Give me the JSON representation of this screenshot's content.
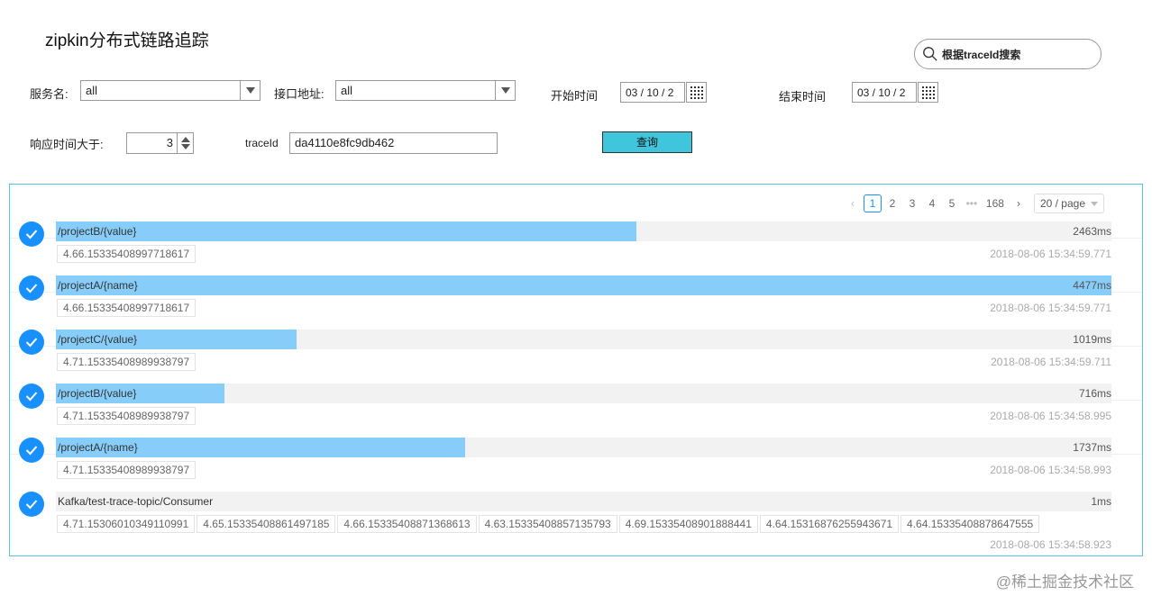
{
  "title": "zipkin分布式链路追踪",
  "search": {
    "placeholder": "根据traceId搜索"
  },
  "filters": {
    "service_label": "服务名:",
    "service_value": "all",
    "endpoint_label": "接口地址:",
    "endpoint_value": "all",
    "start_label": "开始时间",
    "start_value": "03 / 10 / 2",
    "end_label": "结束时间",
    "end_value": "03 / 10 / 2",
    "resp_label": "响应时间大于:",
    "resp_value": "3",
    "traceid_label": "traceId",
    "traceid_value": "da4110e8fc9db462",
    "query_button": "查询"
  },
  "pagination": {
    "pages": [
      "1",
      "2",
      "3",
      "4",
      "5"
    ],
    "current": "1",
    "ellipsis": "•••",
    "last": "168",
    "page_size": "20 / page",
    "prev": "‹",
    "next": "›"
  },
  "traces": [
    {
      "route": "/projectB/{value}",
      "duration": "2463ms",
      "fraction": 0.55,
      "tags": [
        "4.66.15335408997718617"
      ],
      "time": "2018-08-06 15:34:59.771"
    },
    {
      "route": "/projectA/{name}",
      "duration": "4477ms",
      "fraction": 1.0,
      "tags": [
        "4.66.15335408997718617"
      ],
      "time": "2018-08-06 15:34:59.771"
    },
    {
      "route": "/projectC/{value}",
      "duration": "1019ms",
      "fraction": 0.228,
      "tags": [
        "4.71.15335408989938797"
      ],
      "time": "2018-08-06 15:34:59.711"
    },
    {
      "route": "/projectB/{value}",
      "duration": "716ms",
      "fraction": 0.16,
      "tags": [
        "4.71.15335408989938797"
      ],
      "time": "2018-08-06 15:34:58.995"
    },
    {
      "route": "/projectA/{name}",
      "duration": "1737ms",
      "fraction": 0.388,
      "tags": [
        "4.71.15335408989938797"
      ],
      "time": "2018-08-06 15:34:58.993"
    },
    {
      "route": "Kafka/test-trace-topic/Consumer",
      "duration": "1ms",
      "fraction": 0.0,
      "tags": [
        "4.71.15306010349110991",
        "4.65.15335408861497185",
        "4.66.15335408871368613",
        "4.63.15335408857135793",
        "4.69.15335408901888441",
        "4.64.15316876255943671",
        "4.64.15335408878647555"
      ],
      "time": "2018-08-06 15:34:58.923"
    }
  ],
  "watermark": "@稀土掘金技术社区",
  "colors": {
    "accent": "#1890ff",
    "bar_fill": "#87cdf9",
    "query_button": "#40c6dc",
    "panel_border": "#5cc4d8"
  }
}
